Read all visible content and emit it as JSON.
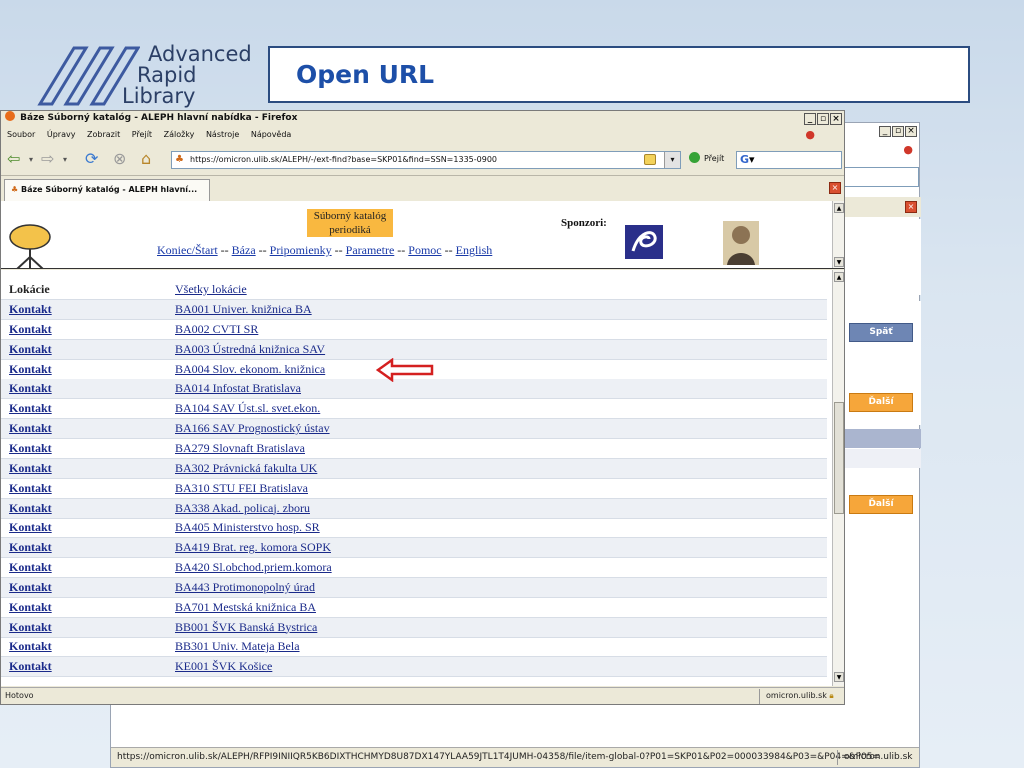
{
  "slide": {
    "logo_words": [
      "Advanced",
      "Rapid",
      "Library"
    ],
    "title": "Open URL"
  },
  "browser": {
    "window_title": "Báze Súborný katalóg - ALEPH hlavní nabídka - Firefox",
    "menu": [
      "Soubor",
      "Úpravy",
      "Zobrazit",
      "Přejít",
      "Záložky",
      "Nástroje",
      "Nápověda"
    ],
    "url": "https://omicron.ulib.sk/ALEPH/-/ext-find?base=SKP01&find=SSN=1335-0900",
    "go_label": "Přejít",
    "search_value": "G",
    "tab_label": "Báze Súborný katalóg - ALEPH hlavní...",
    "status": "Hotovo",
    "status_domain": "omicron.ulib.sk"
  },
  "top_frame": {
    "catalog_lines": [
      "Súborný katalóg",
      "periodiká"
    ],
    "sponsors_label": "Sponzori:",
    "links": [
      "Koniec/Štart",
      "Báza",
      "Pripomienky",
      "Parametre",
      "Pomoc",
      "English"
    ],
    "separator": "--"
  },
  "listing": {
    "header": {
      "col1": "Lokácie",
      "col2": "Všetky lokácie"
    },
    "contact_label": "Kontakt",
    "rows": [
      "BA001 Univer. knižnica BA",
      "BA002 CVTI SR",
      "BA003 Ústredná knižnica SAV",
      "BA004 Slov. ekonom. knižnica",
      "BA014 Infostat Bratislava",
      "BA104 SAV Úst.sl. svet.ekon.",
      "BA166 SAV Prognostický ústav",
      "BA279 Slovnaft Bratislava",
      "BA302 Právnická fakulta UK",
      "BA310 STU FEI Bratislava",
      "BA338 Akad. policaj. zboru",
      "BA405 Ministerstvo hosp. SR",
      "BA419 Brat. reg. komora SOPK",
      "BA420 Sl.obchod.priem.komora",
      "BA443 Protimonopolný úrad",
      "BA701 Mestská knižnica BA",
      "BB001 ŠVK Banská Bystrica",
      "BB301 Univ. Mateja Bela",
      "KE001 ŠVK Košice"
    ],
    "highlighted_index": 3
  },
  "bg_window": {
    "buttons": {
      "back": "Späť",
      "next1": "Ďalší",
      "next2": "Ďalší"
    },
    "status_url": "https://omicron.ulib.sk/ALEPH/RFPI9INIIQR5KB6DIXTHCHMYD8U87DX147YLAA59JTL1T4JUMH-04358/file/item-global-0?P01=SKP01&P02=000033984&P03=&P04=&P05=",
    "status_domain": "omicron.ulib.sk"
  },
  "colors": {
    "title_blue": "#1d4fa8",
    "link_blue": "#1a2a8a",
    "catalog_orange": "#f9b840",
    "arrow_red": "#d42020"
  },
  "icons": [
    "firefox-icon",
    "back-arrow-icon",
    "forward-arrow-icon",
    "reload-icon",
    "stop-icon",
    "home-icon",
    "lock-icon",
    "go-icon",
    "close-tab-icon",
    "red-arrow-icon"
  ]
}
